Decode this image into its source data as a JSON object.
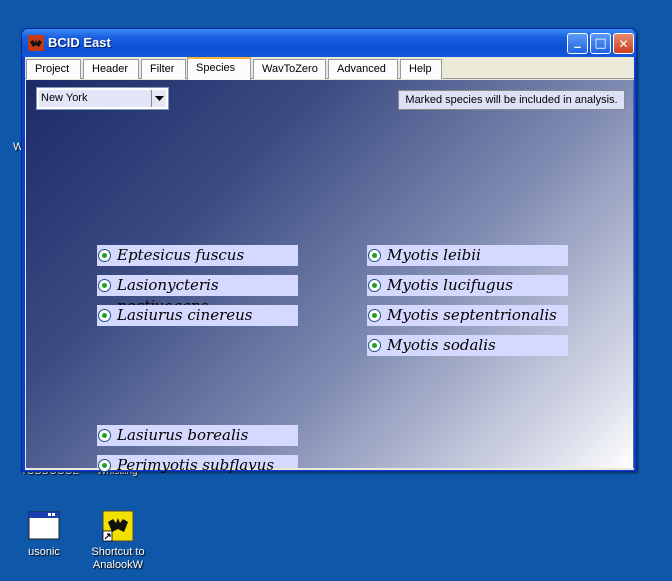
{
  "desktop": {
    "icons": [
      {
        "label": "usonic"
      },
      {
        "label": "Shortcut to AnalookW"
      }
    ],
    "partial_texts": [
      "W",
      "TODDOOOE",
      "Whistling"
    ]
  },
  "window": {
    "title": "BCID East",
    "controls": {
      "minimize": "_",
      "maximize": "□",
      "close": "✕"
    },
    "tabs": [
      {
        "label": "Project"
      },
      {
        "label": "Header"
      },
      {
        "label": "Filter"
      },
      {
        "label": "Species",
        "active": true
      },
      {
        "label": "WavToZero"
      },
      {
        "label": "Advanced"
      },
      {
        "label": "Help"
      }
    ]
  },
  "species_panel": {
    "region_select": {
      "value": "New York"
    },
    "note": "Marked species will be included in analysis.",
    "left_column": [
      {
        "name": "Eptesicus fuscus",
        "checked": true
      },
      {
        "name": "Lasionycteris noctivagans",
        "checked": true
      },
      {
        "name": "Lasiurus cinereus",
        "checked": true
      }
    ],
    "right_column": [
      {
        "name": "Myotis leibii",
        "checked": true
      },
      {
        "name": "Myotis lucifugus",
        "checked": true
      },
      {
        "name": "Myotis septentrionalis",
        "checked": true
      },
      {
        "name": "Myotis sodalis",
        "checked": true
      }
    ],
    "bottom_column": [
      {
        "name": "Lasiurus borealis",
        "checked": true
      },
      {
        "name": "Perimyotis subflavus",
        "checked": true
      }
    ]
  },
  "colors": {
    "desktop": "#0f57a8",
    "titlebar": "#0d4fd8",
    "species_bg": "#d6d9ff",
    "radio_dot": "#21a121",
    "tab_accent": "#f7b43e"
  }
}
